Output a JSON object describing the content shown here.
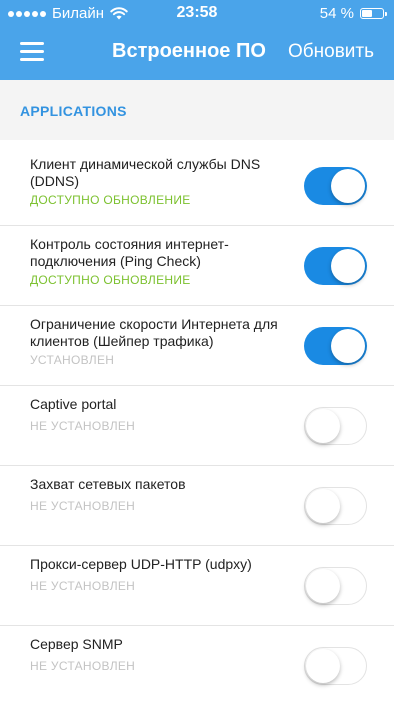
{
  "status_bar": {
    "carrier": "Билайн",
    "time": "23:58",
    "battery": "54 %",
    "battery_level": 0.54
  },
  "nav": {
    "title": "Встроенное ПО",
    "action": "Обновить"
  },
  "section": {
    "title": "APPLICATIONS"
  },
  "colors": {
    "header_bg": "#4aa4ea",
    "accent": "#1a8ae3",
    "update_available": "#7cc12f",
    "muted": "#c3c3c3"
  },
  "apps": [
    {
      "name": "Клиент динамической службы DNS (DDNS)",
      "status": "ДОСТУПНО ОБНОВЛЕНИЕ",
      "enabled": true
    },
    {
      "name": "Контроль состояния интернет-подключения (Ping Check)",
      "status": "ДОСТУПНО ОБНОВЛЕНИЕ",
      "enabled": true
    },
    {
      "name": "Ограничение скорости Интернета для клиентов (Шейпер трафика)",
      "status": "УСТАНОВЛЕН",
      "enabled": true
    },
    {
      "name": "Captive portal",
      "status": "НЕ УСТАНОВЛЕН",
      "enabled": false
    },
    {
      "name": "Захват сетевых пакетов",
      "status": "НЕ УСТАНОВЛЕН",
      "enabled": false
    },
    {
      "name": "Прокси-сервер UDP-HTTP (udpxy)",
      "status": "НЕ УСТАНОВЛЕН",
      "enabled": false
    },
    {
      "name": "Сервер SNMP",
      "status": "НЕ УСТАНОВЛЕН",
      "enabled": false
    }
  ]
}
